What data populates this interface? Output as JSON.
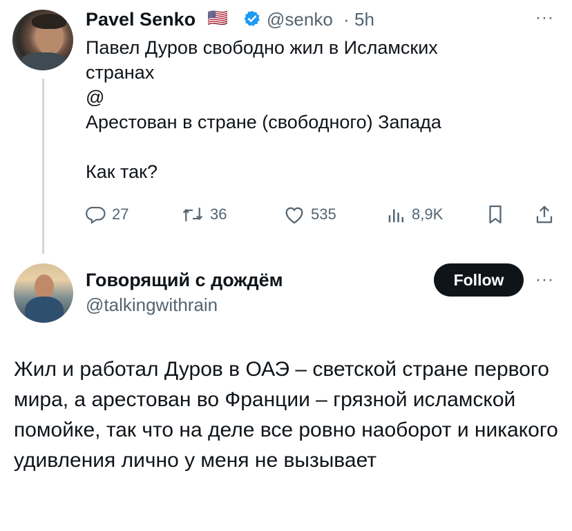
{
  "tweet": {
    "author_name": "Pavel Senko",
    "flag": "🇺🇸",
    "handle": "@senko",
    "separator": "·",
    "time": "5h",
    "more": "···",
    "text": "Павел Дуров свободно жил в Исламских\nстранах\n@\nАрестован в стране (свободного) Запада\n\nКак так?",
    "stats": {
      "replies": "27",
      "reposts": "36",
      "likes": "535",
      "views": "8,9K"
    }
  },
  "reply": {
    "author_name": "Говорящий с дождём",
    "handle": "@talkingwithrain",
    "follow_label": "Follow",
    "more": "···",
    "text": "Жил и работал Дуров в ОАЭ – светской стране первого мира, а арестован во Франции – грязной исламской помойке, так что на деле все ровно наоборот и никакого удивления лично у меня не вызывает"
  },
  "colors": {
    "text": "#0f1419",
    "secondary": "#536471",
    "verified": "#1d9bf0",
    "follow_bg": "#0f1419",
    "thread_line": "#cfd9de"
  },
  "icons": [
    "verified-badge-icon",
    "reply-icon",
    "repost-icon",
    "like-icon",
    "views-icon",
    "bookmark-icon",
    "share-icon",
    "more-icon"
  ]
}
